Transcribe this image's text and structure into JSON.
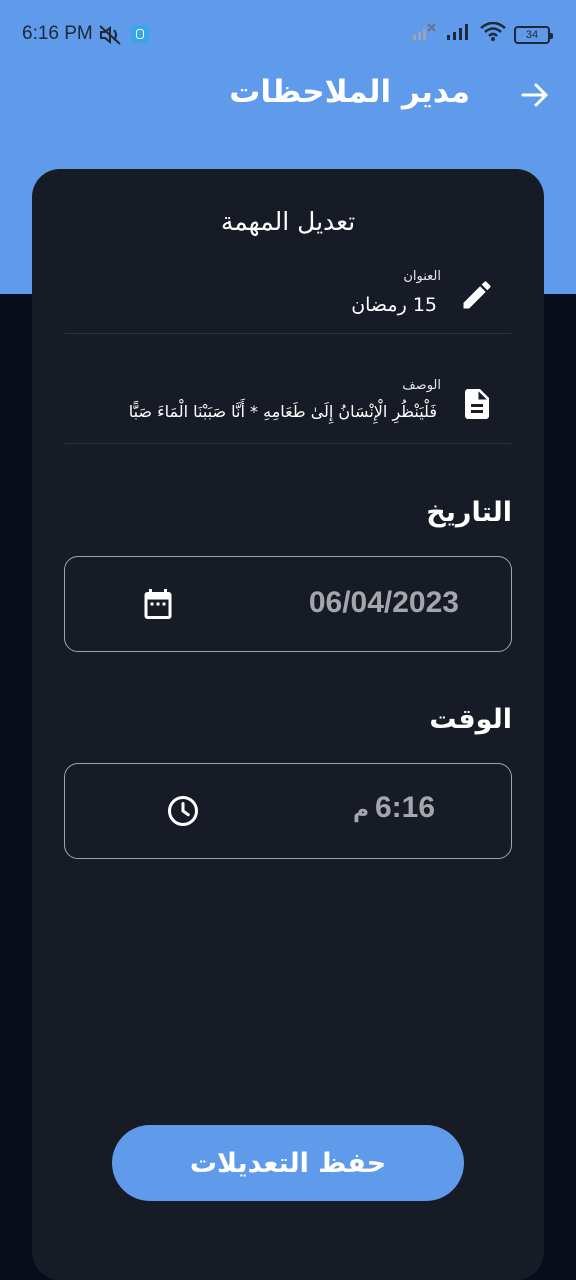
{
  "status_bar": {
    "time": "6:16 PM",
    "battery": "34",
    "icons": [
      "mute-icon",
      "shield-app-icon",
      "signal-off-icon",
      "signal-icon",
      "wifi-icon",
      "battery-icon"
    ]
  },
  "app_bar": {
    "title": "مدير الملاحظات",
    "back_icon": "arrow-forward-icon"
  },
  "form": {
    "heading": "تعديل المهمة",
    "title_field": {
      "label": "العنوان",
      "value": "15 رمضان",
      "icon": "edit-pencil-icon"
    },
    "description_field": {
      "label": "الوصف",
      "value": "فَلْيَنْظُرِ الْإِنْسَانُ إِلَىٰ طَعَامِهِ * أَنَّا صَبَبْنَا الْمَاءَ صَبًّا",
      "icon": "document-icon"
    },
    "date_section": {
      "label": "التاريخ",
      "value": "06/04/2023",
      "icon": "calendar-icon"
    },
    "time_section": {
      "label": "الوقت",
      "value": "6:16",
      "suffix": "م",
      "icon": "clock-icon"
    },
    "save_button": "حفظ التعديلات"
  },
  "colors": {
    "primary": "#5f9bea",
    "card": "#171b25",
    "background": "#060c1a"
  }
}
